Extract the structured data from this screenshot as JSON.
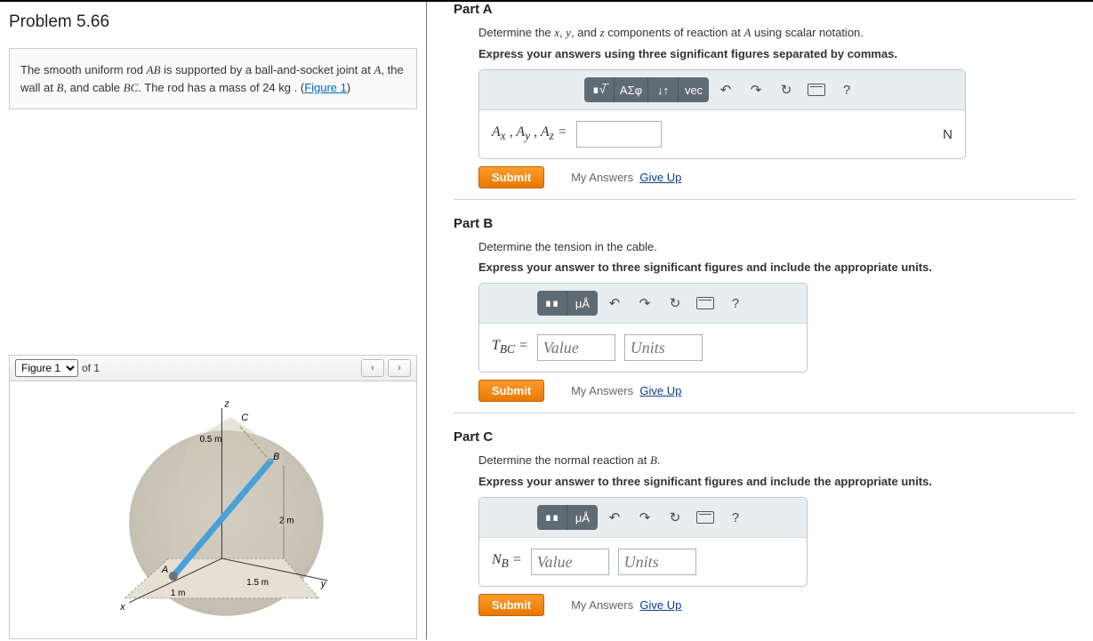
{
  "problem": {
    "title": "Problem 5.66",
    "text_before_AB": "The smooth uniform rod ",
    "AB": "AB",
    "text_mid1": " is supported by a ball-and-socket joint at ",
    "A": "A",
    "text_mid2": ", the wall at ",
    "B": "B",
    "text_mid3": ", and cable ",
    "BC": "BC",
    "text_mid4": ". The rod has a mass of 24 ",
    "kg": "kg",
    "text_end": " . (",
    "fig_link": "Figure 1",
    "text_close": ")"
  },
  "figure": {
    "select_value": "Figure 1",
    "of_label": "of 1",
    "prev": "‹",
    "next": "›",
    "labels": {
      "x": "x",
      "y": "y",
      "z": "z",
      "A": "A",
      "B": "B",
      "C": "C",
      "d05": "0.5 m",
      "d2": "2 m",
      "d15": "1.5 m",
      "d1": "1 m"
    }
  },
  "partA": {
    "title": "Part A",
    "prompt_pre": "Determine the ",
    "x": "x",
    "y": "y",
    "z": "z",
    "prompt_mid1": ", ",
    "prompt_mid2": ", and ",
    "prompt_mid3": " components of reaction at ",
    "A": "A",
    "prompt_post": " using scalar notation.",
    "instr": "Express your answers using three significant figures separated by commas.",
    "lhs": "Aₓ , Aᵧ , A_z =",
    "unit": "N",
    "toolbar": {
      "tpl": "∎√̅",
      "greek": "ΑΣφ",
      "arrows": "↓↑",
      "vec": "vec",
      "undo": "↶",
      "redo": "↷",
      "reset": "↻",
      "help": "?"
    }
  },
  "partB": {
    "title": "Part B",
    "prompt": "Determine the tension in the cable.",
    "instr": "Express your answer to three significant figures and include the appropriate units.",
    "lhs_pre": "T",
    "lhs_sub": "BC",
    "eq": " =",
    "value_ph": "Value",
    "units_ph": "Units",
    "toolbar": {
      "tpl": "∎∎",
      "units": "μÅ",
      "undo": "↶",
      "redo": "↷",
      "reset": "↻",
      "help": "?"
    }
  },
  "partC": {
    "title": "Part C",
    "prompt_pre": "Determine the normal reaction at ",
    "B": "B",
    "prompt_post": ".",
    "instr": "Express your answer to three significant figures and include the appropriate units.",
    "lhs_pre": "N",
    "lhs_sub": "B",
    "eq": " =",
    "value_ph": "Value",
    "units_ph": "Units",
    "toolbar": {
      "tpl": "∎∎",
      "units": "μÅ",
      "undo": "↶",
      "redo": "↷",
      "reset": "↻",
      "help": "?"
    }
  },
  "actions": {
    "submit": "Submit",
    "my_answers": "My Answers",
    "give_up": "Give Up"
  }
}
